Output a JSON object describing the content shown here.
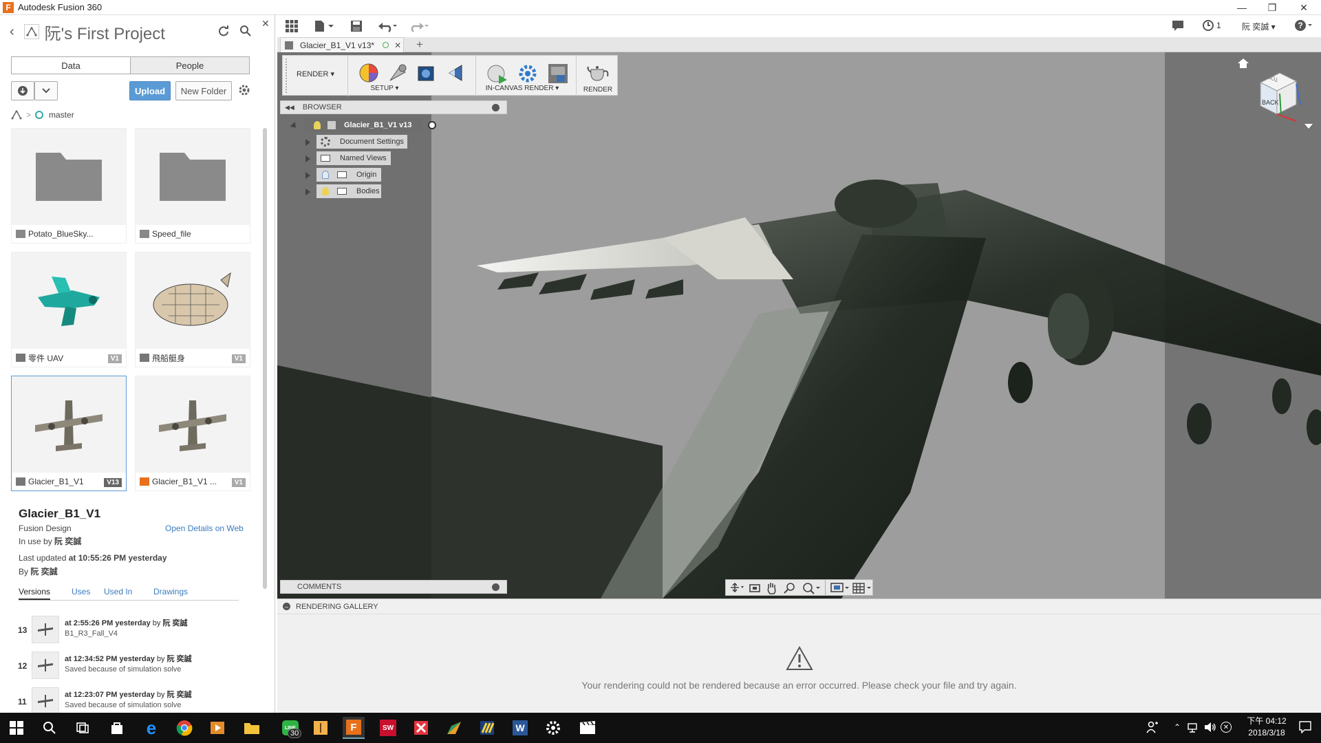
{
  "window": {
    "title": "Autodesk Fusion 360",
    "user_name": "阮 奕誠",
    "notifications_count": "1"
  },
  "left_panel": {
    "project_title": "阮's First Project",
    "tabs": [
      "Data",
      "People"
    ],
    "upload_label": "Upload",
    "new_folder_label": "New Folder",
    "branch": "master",
    "tiles": [
      {
        "name": "Potato_BlueSky...",
        "version": "",
        "kind": "folder"
      },
      {
        "name": "Speed_file",
        "version": "",
        "kind": "folder"
      },
      {
        "name": "零件 UAV",
        "version": "V1",
        "kind": "design"
      },
      {
        "name": "飛船艇身",
        "version": "V1",
        "kind": "design"
      },
      {
        "name": "Glacier_B1_V1",
        "version": "V13",
        "kind": "design"
      },
      {
        "name": "Glacier_B1_V1 ...",
        "version": "V1",
        "kind": "drawing"
      }
    ],
    "details": {
      "title": "Glacier_B1_V1",
      "type": "Fusion Design",
      "open_web": "Open Details on Web",
      "in_use_prefix": "In use by",
      "in_use_by": "阮 奕誠",
      "updated_prefix": "Last updated",
      "updated_value": "at 10:55:26 PM yesterday",
      "by_prefix": "By",
      "by_user": "阮 奕誠",
      "subtabs": [
        "Versions",
        "Uses",
        "Used In",
        "Drawings"
      ],
      "versions": [
        {
          "num": "13",
          "when": "at 2:55:26 PM yesterday",
          "by": "by",
          "user": "阮 奕誠",
          "note": "B1_R3_Fall_V4"
        },
        {
          "num": "12",
          "when": "at 12:34:52 PM yesterday",
          "by": "by",
          "user": "阮 奕誠",
          "note": "Saved because of simulation solve"
        },
        {
          "num": "11",
          "when": "at 12:23:07 PM yesterday",
          "by": "by",
          "user": "阮 奕誠",
          "note": "Saved because of simulation solve"
        }
      ]
    }
  },
  "document_tab": {
    "label": "Glacier_B1_V1 v13*"
  },
  "toolbar": {
    "workspace": "RENDER",
    "setup_label": "SETUP",
    "incanvas_label": "IN-CANVAS RENDER",
    "render_label": "RENDER"
  },
  "browser": {
    "header": "BROWSER",
    "root": "Glacier_B1_V1 v13",
    "nodes": [
      "Document Settings",
      "Named Views",
      "Origin",
      "Bodies"
    ]
  },
  "comments": {
    "header": "COMMENTS"
  },
  "viewcube": {
    "face": "BACK",
    "top_text": "TOP"
  },
  "gallery": {
    "header": "RENDERING GALLERY",
    "error": "Your rendering could not be rendered because an error occurred. Please check your file and try again."
  },
  "taskbar": {
    "time": "下午 04:12",
    "date": "2018/3/18",
    "line_badge": "30"
  },
  "colors": {
    "accent": "#5b9bd5",
    "viewport_bg": "#9c9c9c",
    "taskbar": "#101010",
    "fusion_orange": "#e8701a"
  }
}
